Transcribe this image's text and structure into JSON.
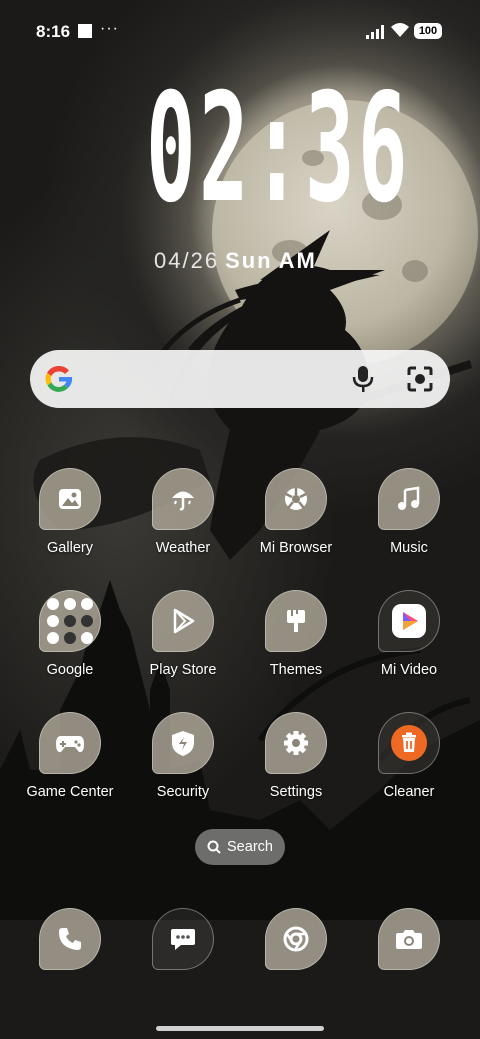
{
  "status_bar": {
    "time": "8:16",
    "more": "···",
    "battery": "100"
  },
  "lock_clock": {
    "time": "02:36",
    "date": "04/26",
    "weekday": "Sun",
    "ampm": "AM"
  },
  "search_widget": {
    "google_icon": "google-g-icon",
    "mic_icon": "mic-icon",
    "lens_icon": "google-lens-icon"
  },
  "apps": [
    {
      "label": "Gallery",
      "icon": "gallery-icon"
    },
    {
      "label": "Weather",
      "icon": "weather-icon"
    },
    {
      "label": "Mi Browser",
      "icon": "browser-icon"
    },
    {
      "label": "Music",
      "icon": "music-icon"
    },
    {
      "label": "Google",
      "icon": "folder-icon"
    },
    {
      "label": "Play Store",
      "icon": "play-store-icon"
    },
    {
      "label": "Themes",
      "icon": "themes-icon"
    },
    {
      "label": "Mi Video",
      "icon": "video-icon"
    },
    {
      "label": "Game Center",
      "icon": "gamepad-icon"
    },
    {
      "label": "Security",
      "icon": "shield-icon"
    },
    {
      "label": "Settings",
      "icon": "gear-icon"
    },
    {
      "label": "Cleaner",
      "icon": "trash-icon"
    }
  ],
  "app_search": {
    "label": "Search"
  },
  "dock": [
    {
      "icon": "phone-icon"
    },
    {
      "icon": "messages-icon"
    },
    {
      "icon": "chrome-icon"
    },
    {
      "icon": "camera-icon"
    }
  ],
  "colors": {
    "tile": "#afa898",
    "cleaner_orange": "#ee6a24",
    "video_gradient": "#ff4d7a"
  }
}
